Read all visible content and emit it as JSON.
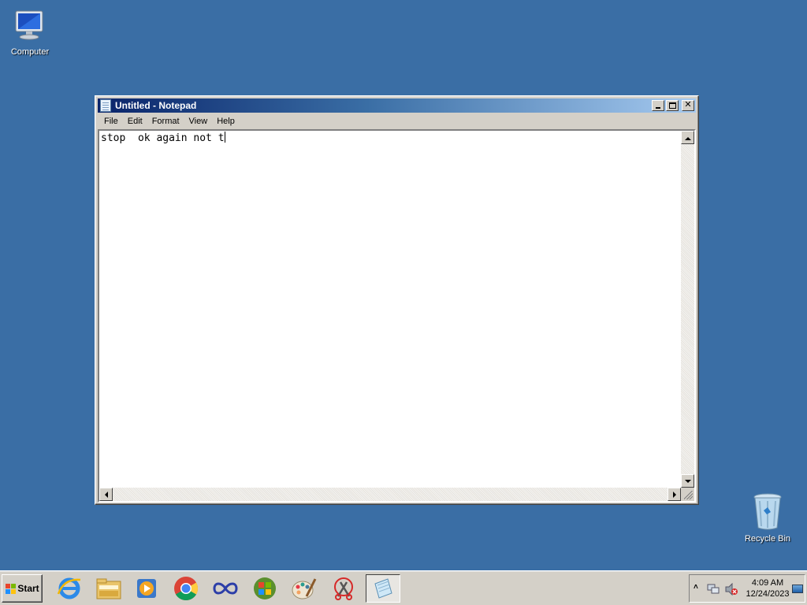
{
  "desktop": {
    "icons": [
      {
        "label": "Computer"
      },
      {
        "label": "Recycle Bin"
      }
    ]
  },
  "notepad": {
    "title": "Untitled - Notepad",
    "menu": [
      "File",
      "Edit",
      "Format",
      "View",
      "Help"
    ],
    "content": "stop  ok again not t"
  },
  "taskbar": {
    "start_label": "Start",
    "pinned": [
      {
        "name": "internet-explorer-icon"
      },
      {
        "name": "windows-explorer-icon"
      },
      {
        "name": "media-player-icon"
      },
      {
        "name": "chrome-icon"
      },
      {
        "name": "infinity-app-icon"
      },
      {
        "name": "windows-logo-app-icon"
      },
      {
        "name": "paint-icon"
      },
      {
        "name": "snipping-tool-icon"
      },
      {
        "name": "notepad-icon"
      }
    ],
    "clock": {
      "time": "4:09 AM",
      "date": "12/24/2023"
    }
  },
  "colors": {
    "desktop": "#3a6ea5",
    "title_start": "#0a246a",
    "title_end": "#a6caf0"
  }
}
